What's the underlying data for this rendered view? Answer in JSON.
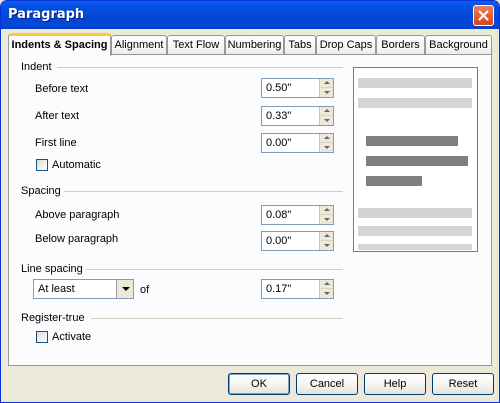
{
  "window": {
    "title": "Paragraph"
  },
  "tabs": [
    {
      "label": "Indents & Spacing",
      "active": true
    },
    {
      "label": "Alignment"
    },
    {
      "label": "Text Flow"
    },
    {
      "label": "Numbering"
    },
    {
      "label": "Tabs"
    },
    {
      "label": "Drop Caps"
    },
    {
      "label": "Borders"
    },
    {
      "label": "Background"
    }
  ],
  "indent": {
    "heading": "Indent",
    "before_text": {
      "label": "Before text",
      "value": "0.50\""
    },
    "after_text": {
      "label": "After text",
      "value": "0.33\""
    },
    "first_line": {
      "label": "First line",
      "value": "0.00\""
    },
    "automatic": {
      "label": "Automatic",
      "checked": false
    }
  },
  "spacing": {
    "heading": "Spacing",
    "above": {
      "label": "Above paragraph",
      "value": "0.08\""
    },
    "below": {
      "label": "Below paragraph",
      "value": "0.00\""
    }
  },
  "line_spacing": {
    "heading": "Line spacing",
    "selected": "At least",
    "of_label": "of",
    "value": "0.17\""
  },
  "register_true": {
    "heading": "Register-true",
    "activate": {
      "label": "Activate",
      "checked": false
    }
  },
  "buttons": {
    "ok": "OK",
    "cancel": "Cancel",
    "help": "Help",
    "reset": "Reset"
  },
  "colors": {
    "titlebar": "#0450e1",
    "active_tab_accent": "#ffc83c",
    "preview_light": "#d4d4d4",
    "preview_dark": "#808080"
  }
}
